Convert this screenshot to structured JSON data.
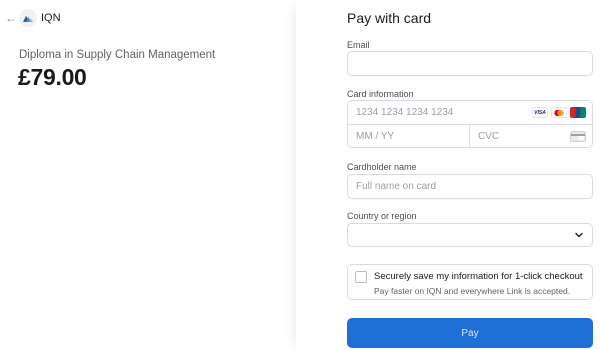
{
  "header": {
    "back_icon": "arrow-left-icon",
    "brand_name": "IQN",
    "logo_icon": "iqn-logo-icon"
  },
  "summary": {
    "product_name": "Diploma in Supply Chain Management",
    "price": "£79.00"
  },
  "payment": {
    "title": "Pay with card",
    "email": {
      "label": "Email",
      "value": "",
      "placeholder": ""
    },
    "card": {
      "label": "Card information",
      "number_placeholder": "1234 1234 1234 1234",
      "expiry_placeholder": "MM / YY",
      "cvc_placeholder": "CVC",
      "brands": [
        {
          "name": "VISA",
          "icon": "visa-icon"
        },
        {
          "name": "Mastercard",
          "icon": "mastercard-icon"
        },
        {
          "name": "UnionPay",
          "icon": "unionpay-icon"
        }
      ]
    },
    "cardholder": {
      "label": "Cardholder name",
      "placeholder": "Full name on card"
    },
    "country": {
      "label": "Country or region",
      "selected": ""
    },
    "save": {
      "checked": false,
      "title": "Securely save my information for 1-click checkout",
      "subtitle": "Pay faster on IQN and everywhere Link is accepted."
    },
    "pay_button": "Pay"
  },
  "colors": {
    "accent": "#1d6fd6",
    "border": "#d9dbe0",
    "muted_text": "#5f6368"
  }
}
